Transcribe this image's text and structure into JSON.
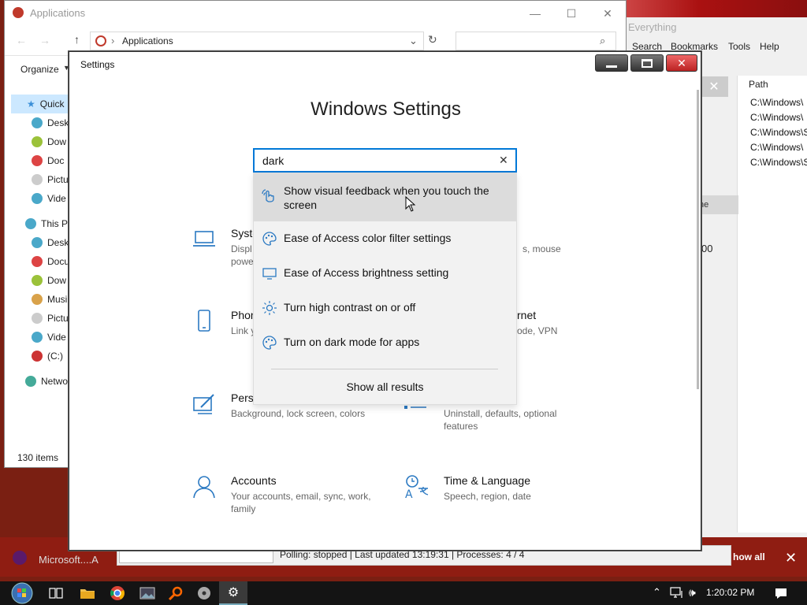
{
  "explorer": {
    "title": "Applications",
    "address": "Applications",
    "organize": "Organize",
    "nav_items": [
      {
        "label": "Quick",
        "color": "#3a8fd8"
      },
      {
        "label": "Desk",
        "color": "#4aa8c9"
      },
      {
        "label": "Dow",
        "color": "#9bc23a"
      },
      {
        "label": "Doc",
        "color": "#d44"
      },
      {
        "label": "Pictu",
        "color": "#ccc"
      },
      {
        "label": "Vide",
        "color": "#4aa8c9"
      },
      {
        "label": "This P",
        "color": "#4aa8c9"
      },
      {
        "label": "Desk",
        "color": "#4aa8c9"
      },
      {
        "label": "Docu",
        "color": "#d44"
      },
      {
        "label": "Dow",
        "color": "#9bc23a"
      },
      {
        "label": "Musi",
        "color": "#d9a24a"
      },
      {
        "label": "Pictu",
        "color": "#ccc"
      },
      {
        "label": "Vide",
        "color": "#4aa8c9"
      },
      {
        "label": "(C:)",
        "color": "#c33"
      },
      {
        "label": "Netwo",
        "color": "#4a9"
      }
    ],
    "item_count": "130 items"
  },
  "everything": {
    "title": "Everything",
    "menu": [
      "Search",
      "Bookmarks",
      "Tools",
      "Help"
    ],
    "path_header": "Path",
    "paths": [
      "C:\\Windows\\",
      "C:\\Windows\\",
      "C:\\Windows\\S",
      "C:\\Windows\\",
      "C:\\Windows\\S"
    ],
    "grey_label": "ne",
    "value": "00",
    "status": "Polling: stopped | Last updated 13:19:31 | Processes: 4 / 4"
  },
  "notification": {
    "text": "Microsoft....A",
    "show_all": "how all"
  },
  "settings": {
    "window_title": "Settings",
    "heading": "Windows Settings",
    "search_value": "dark",
    "suggestions": [
      "Show visual feedback when you touch the screen",
      "Ease of Access color filter settings",
      "Ease of Access brightness setting",
      "Turn high contrast on or off",
      "Turn on dark mode for apps"
    ],
    "show_all": "Show all results",
    "tiles": [
      {
        "name": "Syste",
        "desc": "Displ\npowe",
        "icon": "laptop-icon"
      },
      {
        "name": "",
        "desc": "s, mouse",
        "icon": "devices-icon"
      },
      {
        "name": "Phon",
        "desc": "Link y",
        "icon": "phone-icon"
      },
      {
        "name": "rnet",
        "desc": "ode, VPN",
        "icon": "network-icon"
      },
      {
        "name": "Perso",
        "desc": "Background, lock screen, colors",
        "icon": "personalization-icon"
      },
      {
        "name": "",
        "desc": "Uninstall, defaults, optional features",
        "icon": "apps-icon"
      },
      {
        "name": "Accounts",
        "desc": "Your accounts, email, sync, work, family",
        "icon": "person-icon"
      },
      {
        "name": "Time & Language",
        "desc": "Speech, region, date",
        "icon": "time-language-icon"
      }
    ]
  },
  "taskbar": {
    "clock": "1:20:02 PM"
  },
  "colors": {
    "accent": "#0078d7",
    "settings_icon": "#2b79c2"
  }
}
